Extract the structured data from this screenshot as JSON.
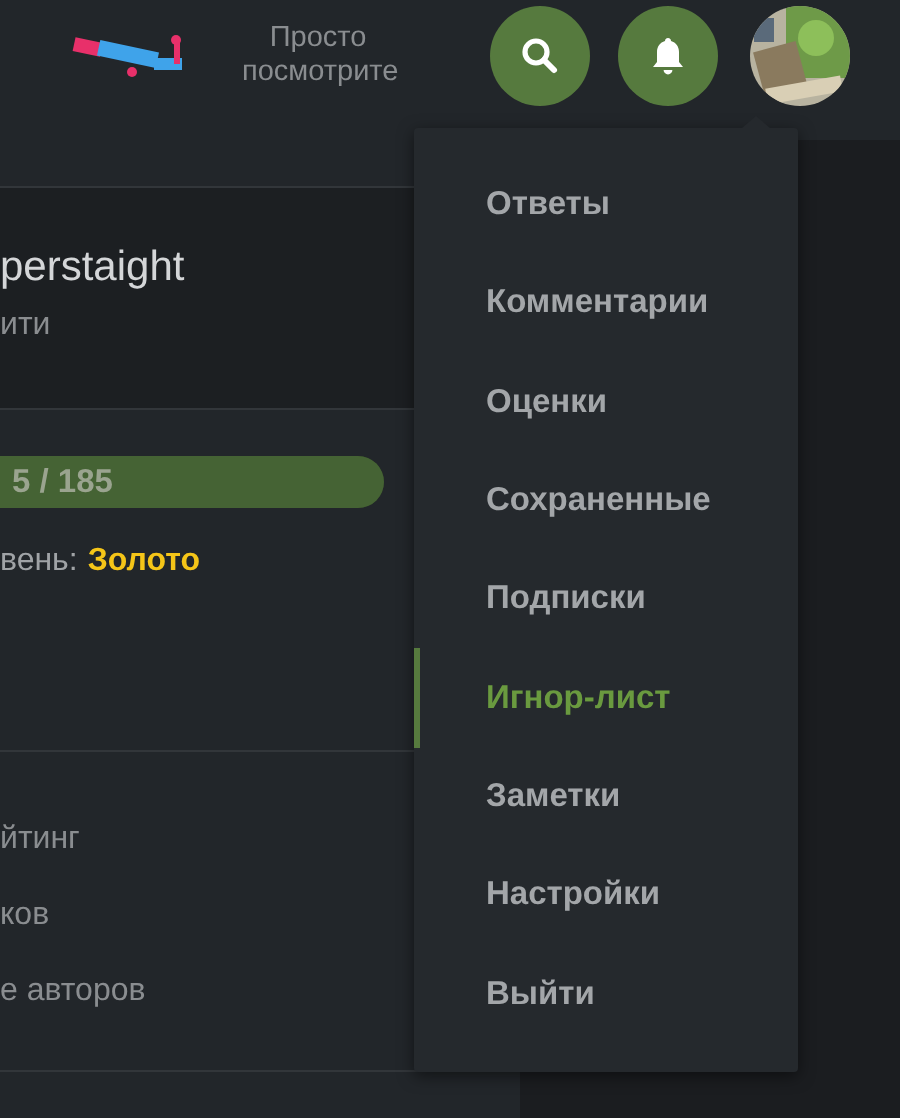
{
  "header": {
    "logo_text": "Просто посмотрите"
  },
  "profile": {
    "name": "perstaight",
    "subtitle": "ити"
  },
  "progress": {
    "reading": "5 / 185",
    "level": 1
  },
  "rank": {
    "label": "вень:",
    "value": "Золото"
  },
  "links": [
    "йтинг",
    "ков",
    "е авторов"
  ],
  "menu": [
    {
      "label": "Ответы",
      "selected": false
    },
    {
      "label": "Комментарии",
      "selected": false
    },
    {
      "label": "Оценки",
      "selected": false
    },
    {
      "label": "Сохраненные",
      "selected": false
    },
    {
      "label": "Подписки",
      "selected": false
    },
    {
      "label": "Игнор-лист",
      "selected": true
    },
    {
      "label": "Заметки",
      "selected": false
    },
    {
      "label": "Настройки",
      "selected": false
    },
    {
      "label": "Выйти",
      "selected": false
    }
  ]
}
